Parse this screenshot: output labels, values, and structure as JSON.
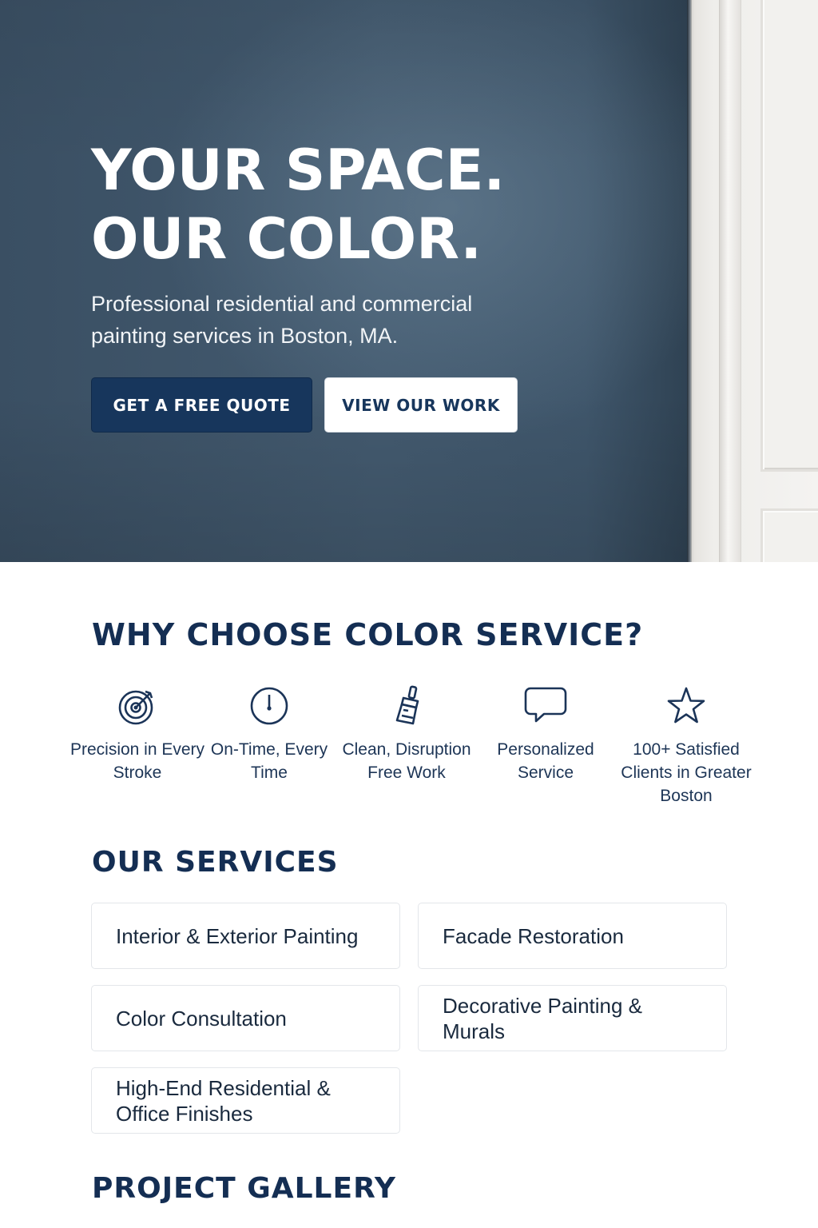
{
  "hero": {
    "title_line1": "YOUR SPACE.",
    "title_line2": "OUR COLOR.",
    "subtitle": "Professional residential and commercial painting services in Boston, MA.",
    "primary_button": "GET A FREE QUOTE",
    "secondary_button": "VIEW OUR WORK",
    "wall_color": "#3e5468",
    "primary_button_color": "#17365c"
  },
  "why": {
    "heading": "WHY CHOOSE COLOR SERVICE?",
    "features": [
      {
        "icon": "target-icon",
        "label": "Precision in Every Stroke"
      },
      {
        "icon": "clock-icon",
        "label": "On-Time, Every Time"
      },
      {
        "icon": "paintbrush-icon",
        "label": "Clean, Disruption Free Work"
      },
      {
        "icon": "chat-bubble-icon",
        "label": "Personalized Service"
      },
      {
        "icon": "star-icon",
        "label": "100+ Satisfied Clients in Greater Boston"
      }
    ]
  },
  "services": {
    "heading": "OUR SERVICES",
    "items": [
      "Interior & Exterior Painting",
      "Facade Restoration",
      "Color Consultation",
      "Decorative Painting & Murals",
      "High-End Residential & Office Finishes"
    ]
  },
  "gallery": {
    "heading": "PROJECT GALLERY"
  },
  "colors": {
    "heading_navy": "#142e53",
    "text_dark": "#1a2a3e"
  }
}
